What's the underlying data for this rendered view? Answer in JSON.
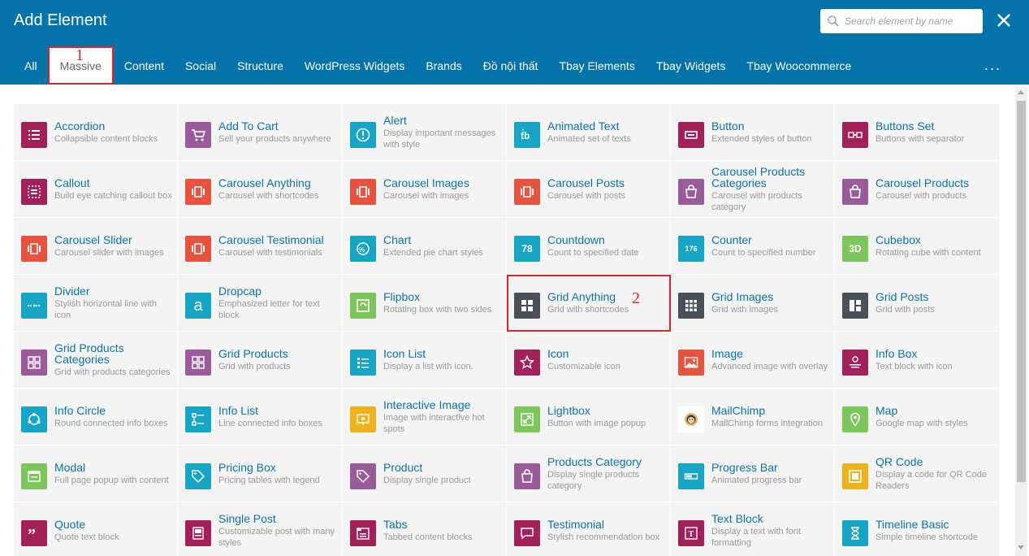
{
  "header": {
    "title": "Add Element",
    "search_placeholder": "Search element by name",
    "more": "..."
  },
  "tabs": [
    "All",
    "Massive",
    "Content",
    "Social",
    "Structure",
    "WordPress Widgets",
    "Brands",
    "Đồ nội thất",
    "Tbay Elements",
    "Tbay Widgets",
    "Tbay Woocommerce"
  ],
  "annotations": {
    "one": "1",
    "two": "2"
  },
  "elements": [
    [
      {
        "name": "Accordion",
        "desc": "Collapsible content blocks",
        "icon": "list-icon",
        "color": "#a3215b"
      },
      {
        "name": "Add To Cart",
        "desc": "Sell your products anywhere",
        "icon": "cart-icon",
        "color": "#9a5b9a"
      },
      {
        "name": "Alert",
        "desc": "Display important messages with style",
        "icon": "alert-icon",
        "color": "#16a5c5"
      },
      {
        "name": "Animated Text",
        "desc": "Animated set of texts",
        "icon": "animated-text-icon",
        "color": "#16a5c5"
      },
      {
        "name": "Button",
        "desc": "Extended styles of button",
        "icon": "button-icon",
        "color": "#a3215b"
      },
      {
        "name": "Buttons Set",
        "desc": "Buttons with separator",
        "icon": "buttons-set-icon",
        "color": "#a3215b"
      }
    ],
    [
      {
        "name": "Callout",
        "desc": "Build eye catching callout box",
        "icon": "callout-icon",
        "color": "#a3215b"
      },
      {
        "name": "Carousel Anything",
        "desc": "Carousel with shortcodes",
        "icon": "carousel-icon",
        "color": "#e8533f"
      },
      {
        "name": "Carousel Images",
        "desc": "Carousel with images",
        "icon": "carousel-icon",
        "color": "#e8533f"
      },
      {
        "name": "Carousel Posts",
        "desc": "Carousel with posts",
        "icon": "carousel-icon",
        "color": "#e8533f"
      },
      {
        "name": "Carousel Products Categories",
        "desc": "Carousel with products category",
        "icon": "bag-icon",
        "color": "#9a5b9a"
      },
      {
        "name": "Carousel Products",
        "desc": "Carousel with products",
        "icon": "bag-icon",
        "color": "#9a5b9a"
      }
    ],
    [
      {
        "name": "Carousel Slider",
        "desc": "Carousel slider with images",
        "icon": "carousel-icon",
        "color": "#e8533f"
      },
      {
        "name": "Carousel Testimonial",
        "desc": "Carousel with testimonials",
        "icon": "carousel-icon",
        "color": "#e8533f"
      },
      {
        "name": "Chart",
        "desc": "Extended pie chart styles",
        "icon": "chart-icon",
        "color": "#16a5c5"
      },
      {
        "name": "Countdown",
        "desc": "Count to specified date",
        "icon": "countdown-icon",
        "color": "#16a5c5",
        "label": "78"
      },
      {
        "name": "Counter",
        "desc": "Count to specified number",
        "icon": "counter-icon",
        "color": "#16a5c5",
        "label": "176"
      },
      {
        "name": "Cubebox",
        "desc": "Rotating cube with content",
        "icon": "cube-icon",
        "color": "#7cc65b",
        "label": "3D"
      }
    ],
    [
      {
        "name": "Divider",
        "desc": "Stylish horizontal line with icon",
        "icon": "divider-icon",
        "color": "#16a5c5"
      },
      {
        "name": "Dropcap",
        "desc": "Emphasized letter for text block",
        "icon": "dropcap-icon",
        "color": "#16a5c5",
        "label": "a"
      },
      {
        "name": "Flipbox",
        "desc": "Rotating box with two sides",
        "icon": "flipbox-icon",
        "color": "#7cc65b"
      },
      {
        "name": "Grid Anything",
        "desc": "Grid with shortcodes",
        "icon": "grid-icon",
        "color": "#4a4f58"
      },
      {
        "name": "Grid Images",
        "desc": "Grid with images",
        "icon": "grid-small-icon",
        "color": "#4a4f58"
      },
      {
        "name": "Grid Posts",
        "desc": "Grid with posts",
        "icon": "grid-posts-icon",
        "color": "#4a4f58"
      }
    ],
    [
      {
        "name": "Grid Products Categories",
        "desc": "Grid with products categories",
        "icon": "grid-products-icon",
        "color": "#9a5b9a"
      },
      {
        "name": "Grid Products",
        "desc": "Grid with products",
        "icon": "grid-products-icon",
        "color": "#9a5b9a"
      },
      {
        "name": "Icon List",
        "desc": "Display a list with icon.",
        "icon": "icon-list-icon",
        "color": "#16a5c5"
      },
      {
        "name": "Icon",
        "desc": "Customizable icon",
        "icon": "star-icon",
        "color": "#a3215b"
      },
      {
        "name": "Image",
        "desc": "Advanced image with overlay",
        "icon": "image-icon",
        "color": "#e8533f"
      },
      {
        "name": "Info Box",
        "desc": "Text block with icon",
        "icon": "info-box-icon",
        "color": "#a3215b"
      }
    ],
    [
      {
        "name": "Info Circle",
        "desc": "Round connected info boxes",
        "icon": "info-circle-icon",
        "color": "#16a5c5"
      },
      {
        "name": "Info List",
        "desc": "Line connected info boxes",
        "icon": "info-list-icon",
        "color": "#16a5c5"
      },
      {
        "name": "Interactive Image",
        "desc": "Image with interactive hot spots",
        "icon": "interactive-image-icon",
        "color": "#f0b21c"
      },
      {
        "name": "Lightbox",
        "desc": "Button with image popup",
        "icon": "lightbox-icon",
        "color": "#7cc65b"
      },
      {
        "name": "MailChimp",
        "desc": "MailChimp forms integration",
        "icon": "mailchimp-icon",
        "color": "#ffffff"
      },
      {
        "name": "Map",
        "desc": "Google map with styles",
        "icon": "map-pin-icon",
        "color": "#7cc65b"
      }
    ],
    [
      {
        "name": "Modal",
        "desc": "Full page popup with content",
        "icon": "modal-icon",
        "color": "#7cc65b"
      },
      {
        "name": "Pricing Box",
        "desc": "Pricing tables with legend",
        "icon": "tag-icon",
        "color": "#16a5c5"
      },
      {
        "name": "Product",
        "desc": "Display single product",
        "icon": "tag-icon",
        "color": "#9a5b9a"
      },
      {
        "name": "Products Category",
        "desc": "Display single products category",
        "icon": "bag-icon",
        "color": "#9a5b9a"
      },
      {
        "name": "Progress Bar",
        "desc": "Animated progress bar",
        "icon": "progress-icon",
        "color": "#16a5c5"
      },
      {
        "name": "QR Code",
        "desc": "Display a code for QR Code Readers",
        "icon": "qr-icon",
        "color": "#f0b21c"
      }
    ],
    [
      {
        "name": "Quote",
        "desc": "Quote text block",
        "icon": "quote-icon",
        "color": "#a3215b"
      },
      {
        "name": "Single Post",
        "desc": "Customizable post with many styles",
        "icon": "post-icon",
        "color": "#a3215b"
      },
      {
        "name": "Tabs",
        "desc": "Tabbed content blocks",
        "icon": "tabs-icon",
        "color": "#a3215b"
      },
      {
        "name": "Testimonial",
        "desc": "Stylish recommendation box",
        "icon": "testimonial-icon",
        "color": "#a3215b"
      },
      {
        "name": "Text Block",
        "desc": "Display a text with font formatting",
        "icon": "text-block-icon",
        "color": "#a3215b"
      },
      {
        "name": "Timeline Basic",
        "desc": "Simple timeline shortcode",
        "icon": "hourglass-icon",
        "color": "#16a5c5"
      }
    ]
  ],
  "colors": {
    "header": "#0473aa",
    "accent_red": "#d9252b",
    "link": "#0b74ad"
  }
}
